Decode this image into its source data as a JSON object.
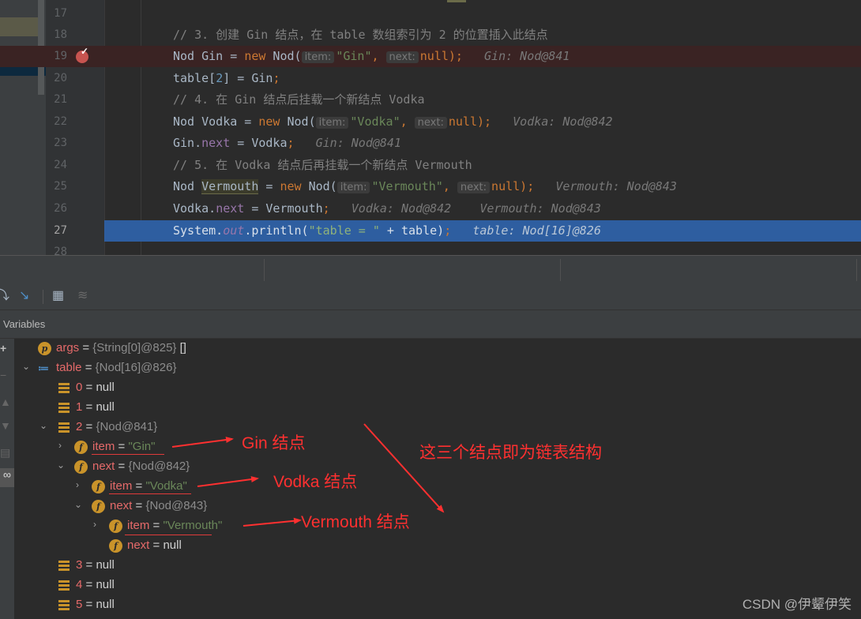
{
  "editor": {
    "lines": [
      {
        "num": "17"
      },
      {
        "num": "18",
        "comment": "// 3. 创建 Gin 结点，在 table 数组索引为 2 的位置插入此结点"
      },
      {
        "num": "19",
        "type": "Nod",
        "var": "Gin",
        "eq": " = ",
        "new": "new",
        "cls": " Nod(",
        "hint1": "item:",
        "arg1": "\"Gin\"",
        "comma": ", ",
        "hint2": "next:",
        "arg2": "null",
        "end": ");",
        "inline": "Gin: Nod@841"
      },
      {
        "num": "20",
        "a": "table[",
        "idx": "2",
        "b": "] = Gin",
        "semi": ";"
      },
      {
        "num": "21",
        "comment": "// 4. 在 Gin 结点后挂载一个新结点 Vodka"
      },
      {
        "num": "22",
        "type": "Nod",
        "var": "Vodka",
        "eq": " = ",
        "new": "new",
        "cls": " Nod(",
        "hint1": "item:",
        "arg1": "\"Vodka\"",
        "comma": ", ",
        "hint2": "next:",
        "arg2": "null",
        "end": ");",
        "inline": "Vodka: Nod@842"
      },
      {
        "num": "23",
        "a": "Gin.",
        "field": "next",
        "b": " = Vodka",
        "semi": ";",
        "inline": "Gin: Nod@841"
      },
      {
        "num": "24",
        "comment": "// 5. 在 Vodka 结点后再挂载一个新结点 Vermouth"
      },
      {
        "num": "25",
        "type": "Nod",
        "var": "Vermouth",
        "eq": " = ",
        "new": "new",
        "cls": " Nod(",
        "hint1": "item:",
        "arg1": "\"Vermouth\"",
        "comma": ", ",
        "hint2": "next:",
        "arg2": "null",
        "end": ");",
        "inline": "Vermouth: Nod@843"
      },
      {
        "num": "26",
        "a": "Vodka.",
        "field": "next",
        "b": " = Vermouth",
        "semi": ";",
        "inline": "Vodka: Nod@842",
        "inline2": "Vermouth: Nod@843"
      },
      {
        "num": "27",
        "sys": "System.",
        "out": "out",
        "println": ".println(",
        "str": "\"table = \"",
        "rest": " + table)",
        "semi": ";",
        "inline": "table: Nod[16]@826"
      },
      {
        "num": "28"
      }
    ]
  },
  "debugger": {
    "panel_title": "Variables",
    "tree": [
      {
        "name": "args",
        "eq": " = ",
        "type": "{String[0]@825}",
        "extra": " []"
      },
      {
        "name": "table",
        "eq": " = ",
        "type": "{Nod[16]@826}"
      },
      {
        "name": "0",
        "eq": " = ",
        "val": "null"
      },
      {
        "name": "1",
        "eq": " = ",
        "val": "null"
      },
      {
        "name": "2",
        "eq": " = ",
        "type": "{Nod@841}"
      },
      {
        "name": "item",
        "eq": " = ",
        "str": "\"Gin\""
      },
      {
        "name": "next",
        "eq": " = ",
        "type": "{Nod@842}"
      },
      {
        "name": "item",
        "eq": " = ",
        "str": "\"Vodka\""
      },
      {
        "name": "next",
        "eq": " = ",
        "type": "{Nod@843}"
      },
      {
        "name": "item",
        "eq": " = ",
        "str": "\"Vermouth\""
      },
      {
        "name": "next",
        "eq": " = ",
        "val": "null"
      },
      {
        "name": "3",
        "eq": " = ",
        "val": "null"
      },
      {
        "name": "4",
        "eq": " = ",
        "val": "null"
      },
      {
        "name": "5",
        "eq": " = ",
        "val": "null"
      }
    ]
  },
  "annotations": {
    "gin": "Gin 结点",
    "vodka": "Vodka 结点",
    "vermouth": "Vermouth 结点",
    "summary": "这三个结点即为链表结构"
  },
  "watermark": "CSDN @伊颦伊笑",
  "colors": {
    "annotation": "#ff3030",
    "current_line": "#2e5ea0",
    "breakpoint": "#c75450"
  }
}
